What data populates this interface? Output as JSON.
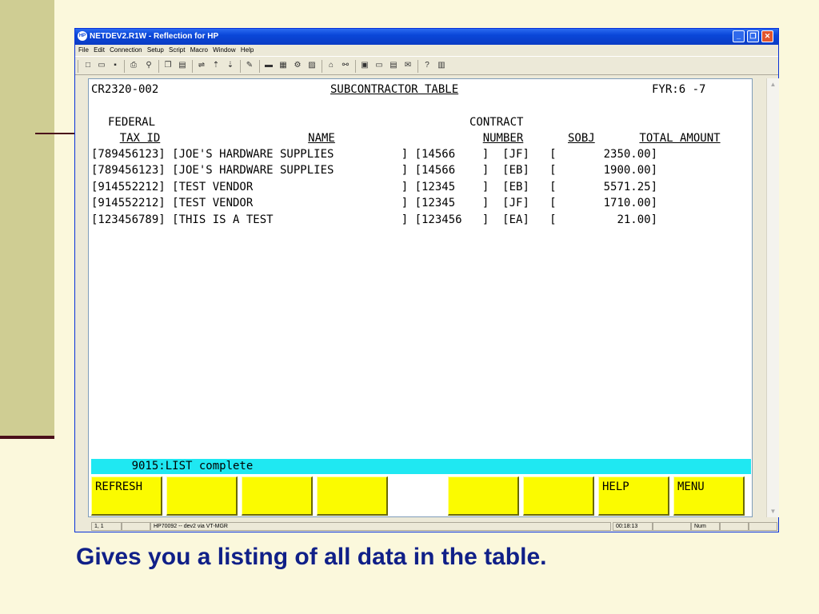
{
  "window": {
    "title": "NETDEV2.R1W - Reflection for HP",
    "app_icon": "HP",
    "buttons": {
      "minimize": "_",
      "restore": "❐",
      "close": "✕"
    }
  },
  "menu": [
    "File",
    "Edit",
    "Connection",
    "Setup",
    "Script",
    "Macro",
    "Window",
    "Help"
  ],
  "toolbar_icons": [
    "new-icon",
    "open-icon",
    "save-icon",
    "print-icon",
    "find-icon",
    "copy-icon",
    "paste-icon",
    "connect-icon",
    "transfer-icon",
    "receive-icon",
    "macro-icon",
    "keyboard-icon",
    "display-icon",
    "settings-icon",
    "color-icon",
    "hosts-icon",
    "link-icon",
    "file-icon",
    "terminal-icon",
    "session-icon",
    "mail-icon",
    "help-icon",
    "book-icon"
  ],
  "terminal": {
    "screen_id": "CR2320-002",
    "table_title": "SUBCONTRACTOR TABLE",
    "fiscal_year": "FYR:6 -7",
    "headers": {
      "fed_tax_line1": "FEDERAL",
      "fed_tax_line2": "TAX ID",
      "name": "NAME",
      "contract_line1": "CONTRACT",
      "contract_line2": "NUMBER",
      "sobj": "SOBJ",
      "total": "TOTAL AMOUNT"
    },
    "rows": [
      "[789456123] [JOE'S HARDWARE SUPPLIES          ] [14566    ]  [JF]   [       2350.00]",
      "[789456123] [JOE'S HARDWARE SUPPLIES          ] [14566    ]  [EB]   [       1900.00]",
      "[914552212] [TEST VENDOR                      ] [12345    ]  [EB]   [       5571.25]",
      "[914552212] [TEST VENDOR                      ] [12345    ]  [JF]   [       1710.00]",
      "[123456789] [THIS IS A TEST                   ] [123456   ]  [EA]   [         21.00]"
    ],
    "status_message": "      9015:LIST complete",
    "function_keys": [
      "REFRESH",
      "",
      "",
      "",
      "",
      "",
      "HELP",
      "MENU"
    ]
  },
  "statusbar": {
    "cursor": "1, 1",
    "host": "HP70092 -- dev2 via VT-MGR",
    "time": "00:18:13",
    "num": "Num"
  },
  "caption": "Gives you a listing of all data in the table."
}
